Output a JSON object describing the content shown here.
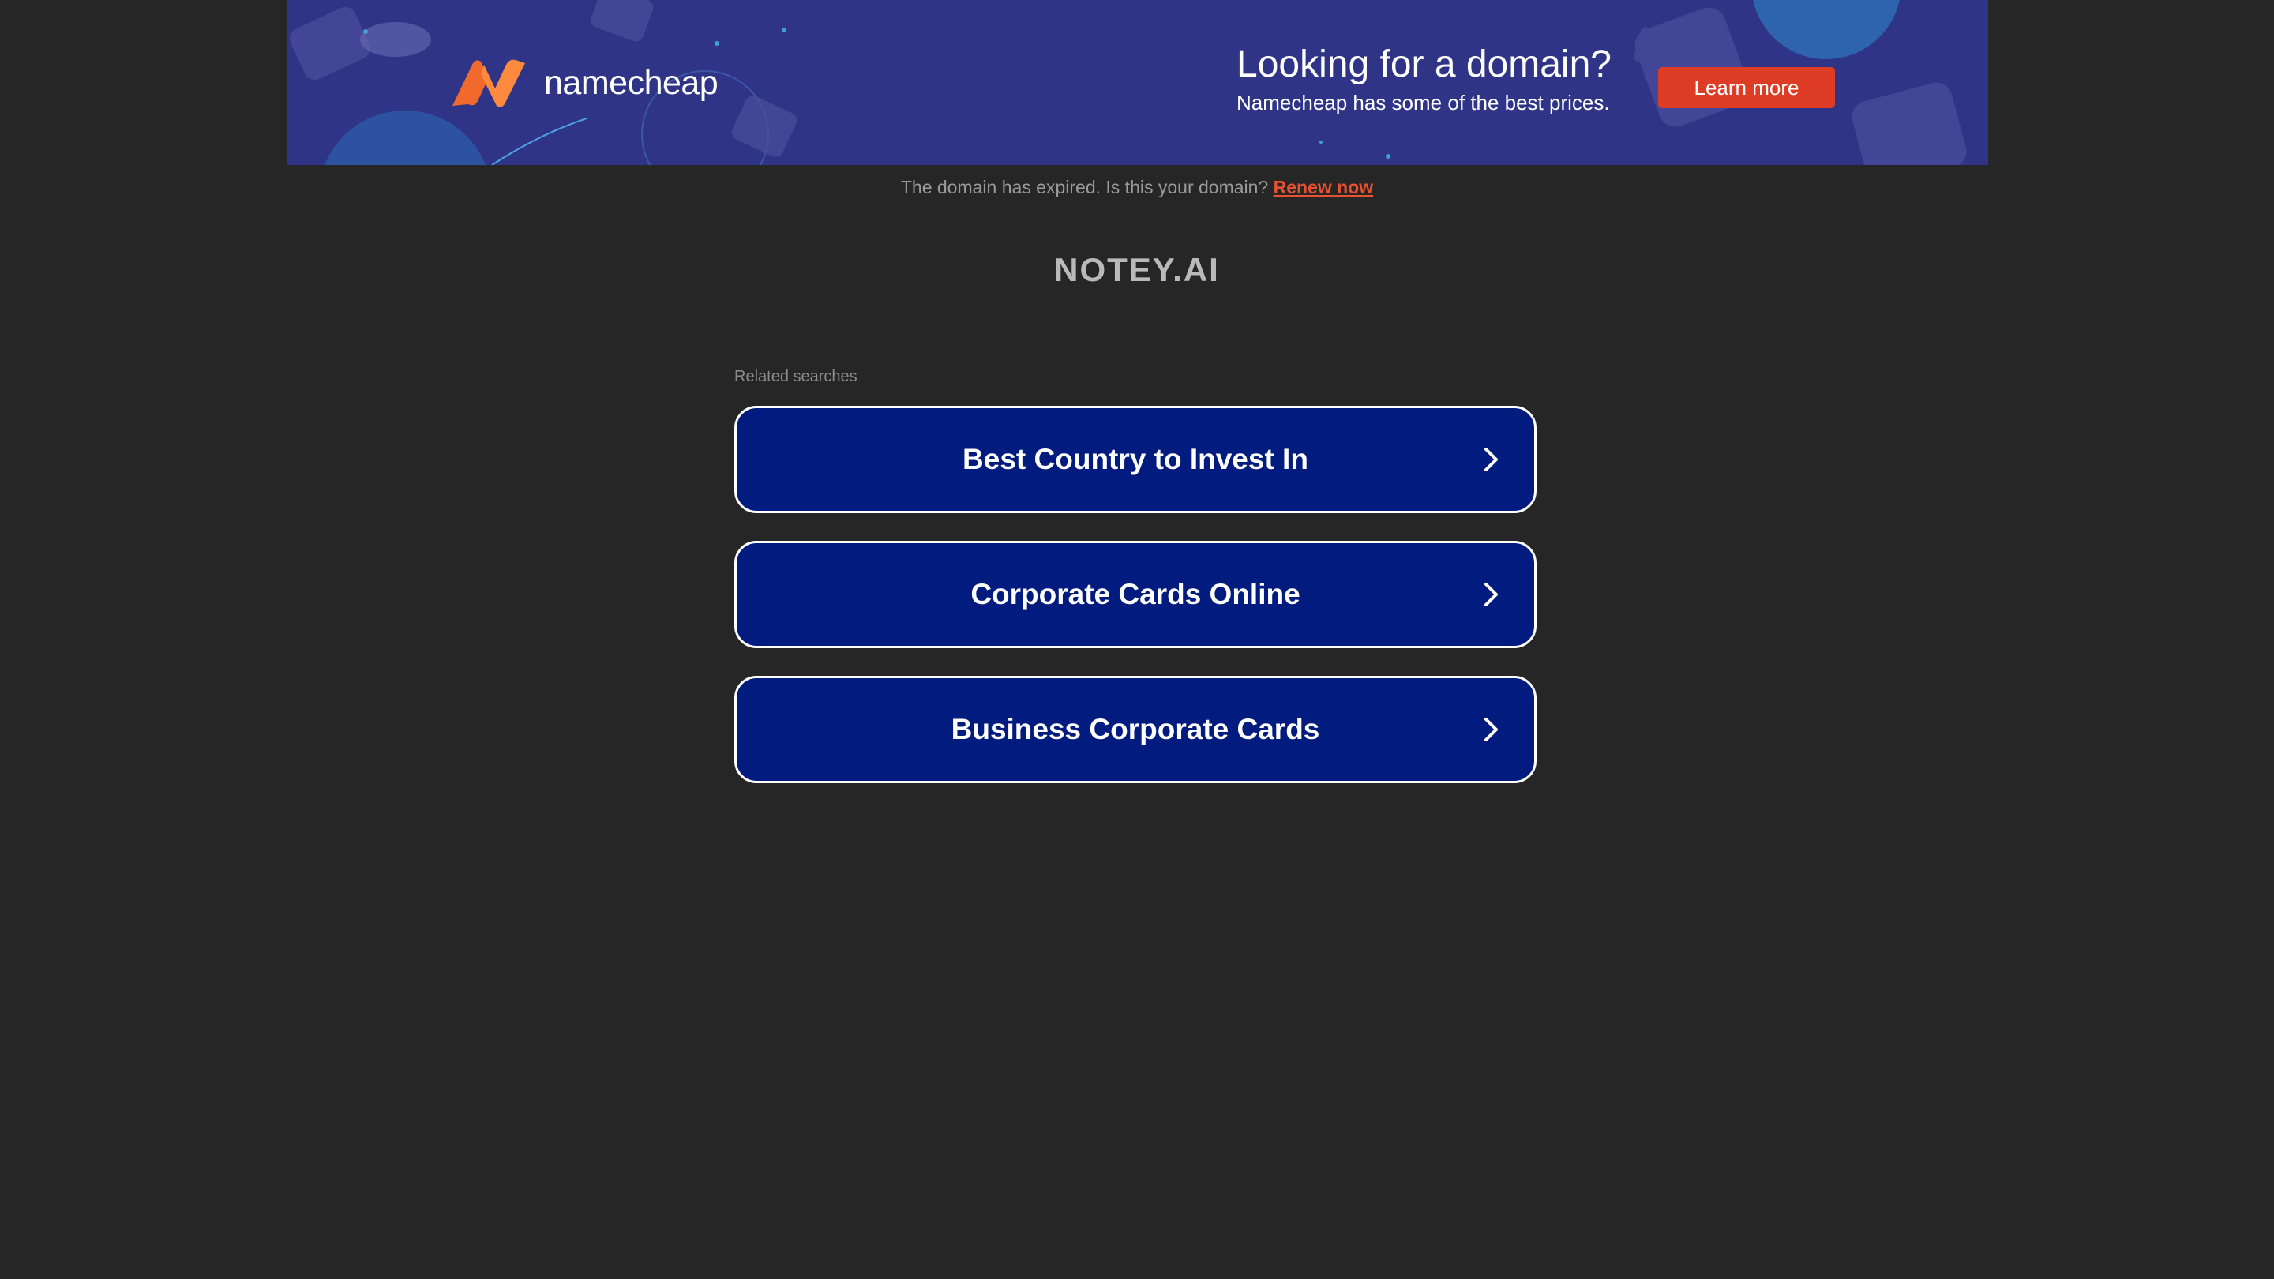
{
  "banner": {
    "brand_name": "namecheap",
    "promo_title": "Looking for a domain?",
    "promo_subtitle": "Namecheap has some of the best prices.",
    "cta_label": "Learn more",
    "colors": {
      "background": "#2f3486",
      "logo_orange": "#f26a2b",
      "cta": "#de3c25"
    }
  },
  "notice": {
    "text": "The domain has expired. Is this your domain?",
    "renew_label": "Renew now"
  },
  "site": {
    "domain": "NOTEY.AI"
  },
  "related": {
    "label": "Related searches",
    "items": [
      {
        "label": "Best Country to Invest In",
        "icon": "chevron-right-icon"
      },
      {
        "label": "Corporate Cards Online",
        "icon": "chevron-right-icon"
      },
      {
        "label": "Business Corporate Cards",
        "icon": "chevron-right-icon"
      }
    ],
    "colors": {
      "button_bg": "#021b7e",
      "button_border": "#ffffff"
    }
  }
}
